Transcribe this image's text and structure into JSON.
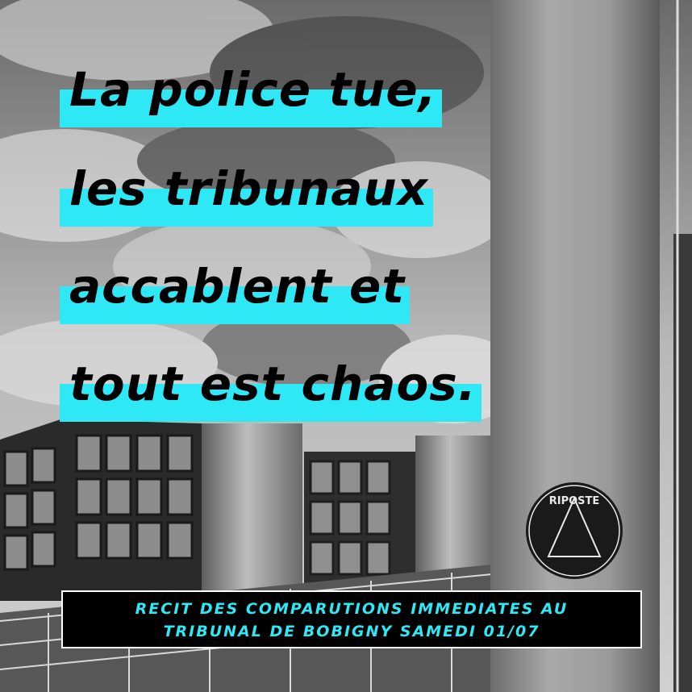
{
  "headline": {
    "lines": [
      "La police tue,",
      "les tribunaux",
      "accablent et",
      "tout est chaos."
    ]
  },
  "sticker": {
    "text": "RIPOSTE"
  },
  "banner": {
    "line1": "RECIT DES COMPARUTIONS IMMEDIATES AU",
    "line2": "TRIBUNAL DE BOBIGNY SAMEDI 01/07"
  },
  "colors": {
    "highlight": "#2ee8f5",
    "banner_bg": "#000000",
    "banner_text": "#2ee8f5"
  }
}
